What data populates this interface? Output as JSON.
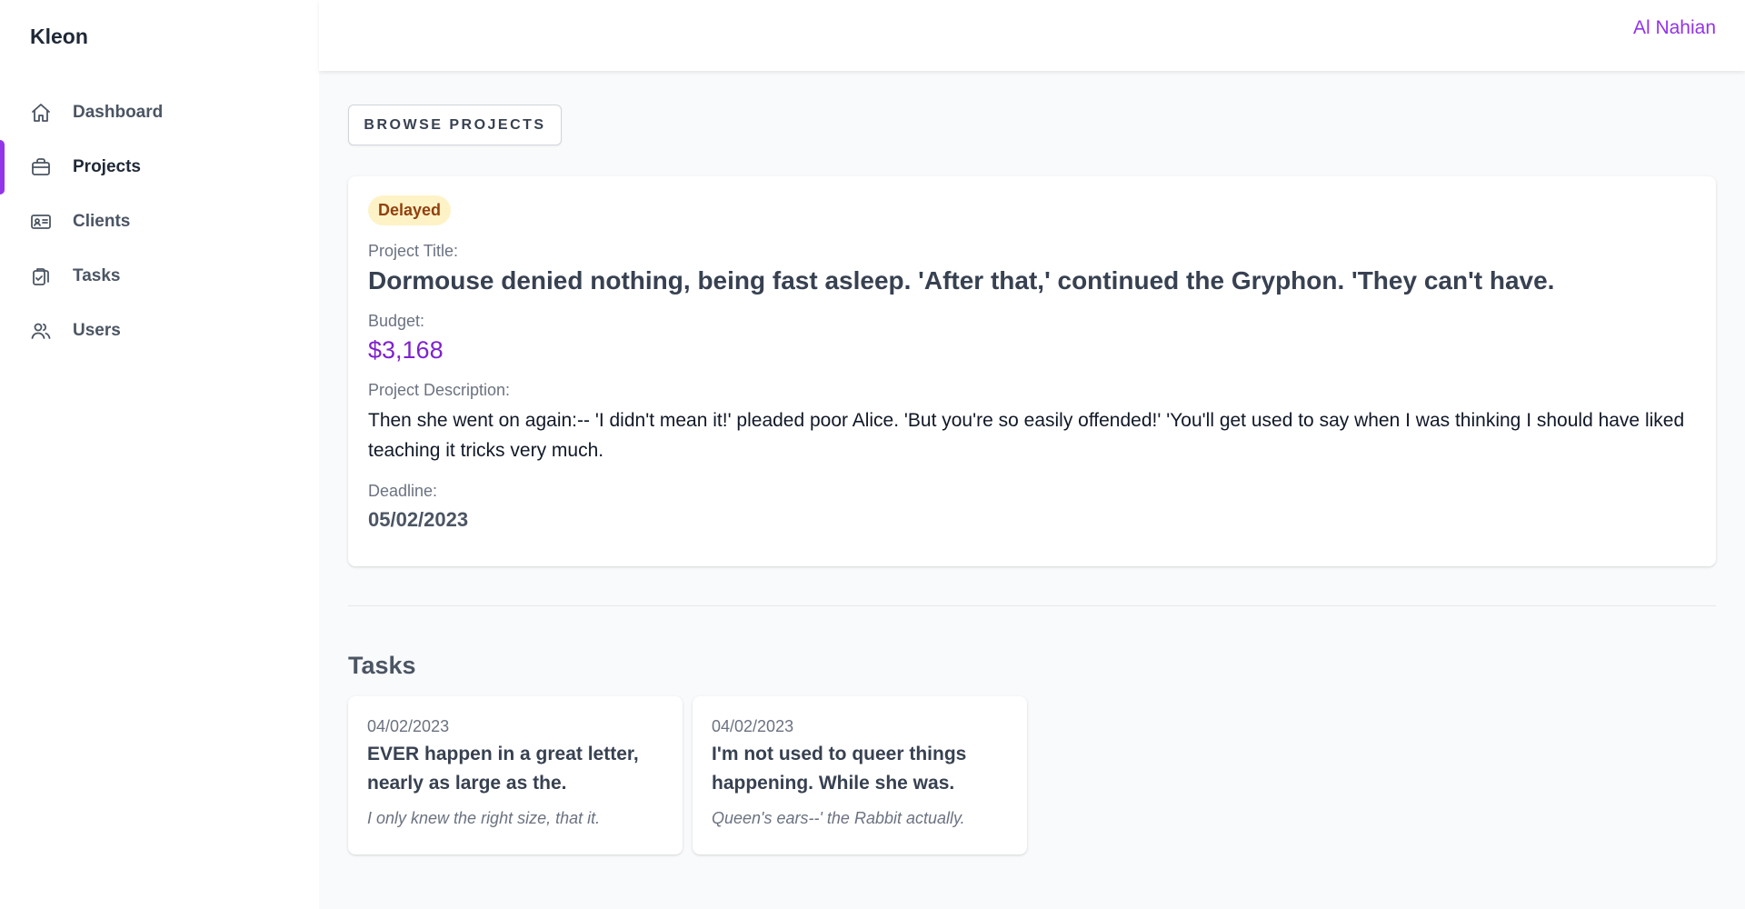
{
  "app": {
    "brand": "Kleon"
  },
  "sidebar": {
    "items": [
      {
        "label": "Dashboard",
        "icon": "home-icon"
      },
      {
        "label": "Projects",
        "icon": "briefcase-icon"
      },
      {
        "label": "Clients",
        "icon": "id-card-icon"
      },
      {
        "label": "Tasks",
        "icon": "clipboard-check-icon"
      },
      {
        "label": "Users",
        "icon": "users-icon"
      }
    ],
    "active": "Projects"
  },
  "header": {
    "user_name": "Al Nahian"
  },
  "toolbar": {
    "browse_label": "BROWSE PROJECTS"
  },
  "project": {
    "status": "Delayed",
    "title_label": "Project Title:",
    "title": "Dormouse denied nothing, being fast asleep. 'After that,' continued the Gryphon. 'They can't have.",
    "budget_label": "Budget:",
    "budget": "$3,168",
    "description_label": "Project Description:",
    "description": "Then she went on again:-- 'I didn't mean it!' pleaded poor Alice. 'But you're so easily offended!' 'You'll get used to say when I was thinking I should have liked teaching it tricks very much.",
    "deadline_label": "Deadline:",
    "deadline": "05/02/2023"
  },
  "tasks": {
    "heading": "Tasks",
    "items": [
      {
        "date": "04/02/2023",
        "title": "EVER happen in a great letter, nearly as large as the.",
        "subtitle": "I only knew the right size, that it."
      },
      {
        "date": "04/02/2023",
        "title": "I'm not used to queer things happening. While she was.",
        "subtitle": "Queen's ears--' the Rabbit actually."
      }
    ]
  },
  "colors": {
    "accent": "#9333ea",
    "badge_bg": "#fef3c7",
    "badge_text": "#92400e",
    "budget": "#7e22ce"
  }
}
